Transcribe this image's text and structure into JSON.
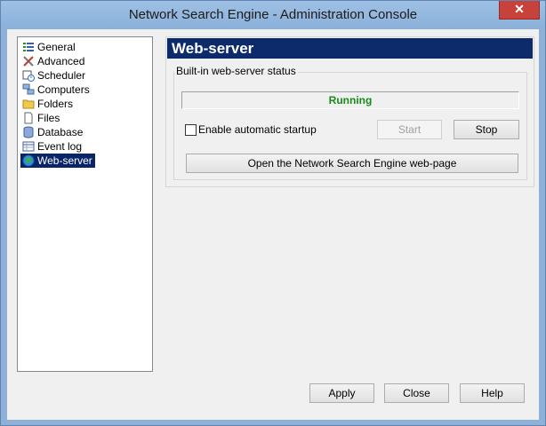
{
  "window": {
    "title": "Network Search Engine - Administration Console",
    "close_glyph": "✕"
  },
  "tree": {
    "items": [
      {
        "label": "General",
        "icon": "list-icon"
      },
      {
        "label": "Advanced",
        "icon": "tools-icon"
      },
      {
        "label": "Scheduler",
        "icon": "scheduler-icon"
      },
      {
        "label": "Computers",
        "icon": "computers-icon"
      },
      {
        "label": "Folders",
        "icon": "folder-icon"
      },
      {
        "label": "Files",
        "icon": "file-icon"
      },
      {
        "label": "Database",
        "icon": "database-icon"
      },
      {
        "label": "Event log",
        "icon": "event-log-icon"
      },
      {
        "label": "Web-server",
        "icon": "globe-icon",
        "selected": true
      }
    ]
  },
  "panel": {
    "header": "Web-server",
    "group_label": "Built-in web-server status",
    "status": "Running",
    "enable_label": "Enable automatic startup",
    "enable_checked": false,
    "start_label": "Start",
    "stop_label": "Stop",
    "open_page_label": "Open the Network Search Engine web-page"
  },
  "footer": {
    "apply": "Apply",
    "close": "Close",
    "help": "Help"
  },
  "colors": {
    "banner": "#0d2b6b",
    "status_running": "#188b18",
    "selection": "#0a246a"
  }
}
